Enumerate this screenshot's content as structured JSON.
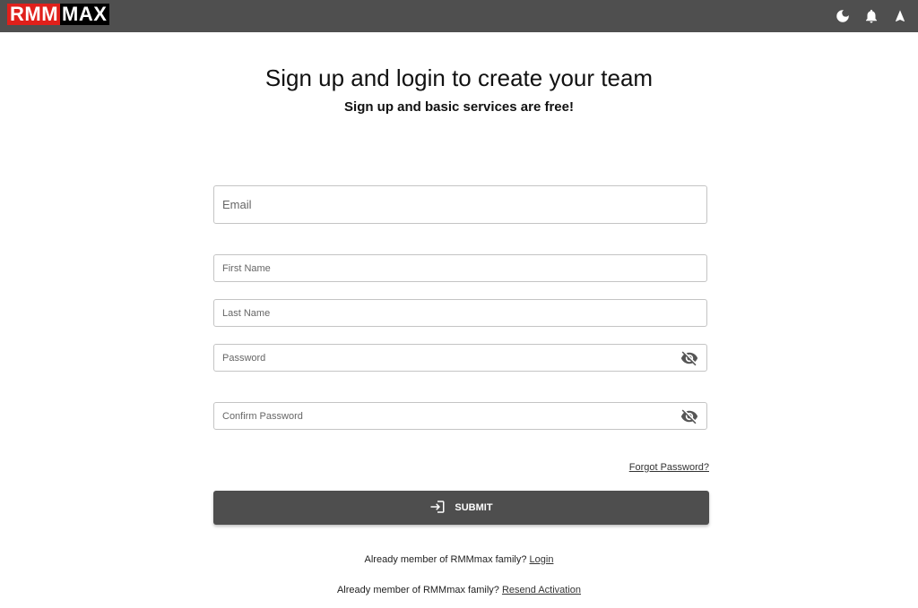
{
  "header": {
    "logo_red": "RMM",
    "logo_black": "MAX",
    "icons": [
      "dark-mode-icon",
      "bell-icon",
      "navigation-icon"
    ]
  },
  "main": {
    "title": "Sign up and login to create your team",
    "subtitle": "Sign up and basic services are free!"
  },
  "form": {
    "email_placeholder": "Email",
    "first_name_placeholder": "First Name",
    "last_name_placeholder": "Last Name",
    "password_placeholder": "Password",
    "confirm_password_placeholder": "Confirm Password",
    "forgot_password": "Forgot Password?",
    "submit_label": "SUBMIT"
  },
  "footer": {
    "login_prompt": "Already member of RMMmax family?",
    "login_link": "Login",
    "resend_prompt": "Already member of RMMmax family?",
    "resend_link": "Resend Activation"
  },
  "colors": {
    "topbar": "#4f4f4f",
    "logo_red": "#e0201b",
    "submit_bg": "#4e4e4e"
  }
}
